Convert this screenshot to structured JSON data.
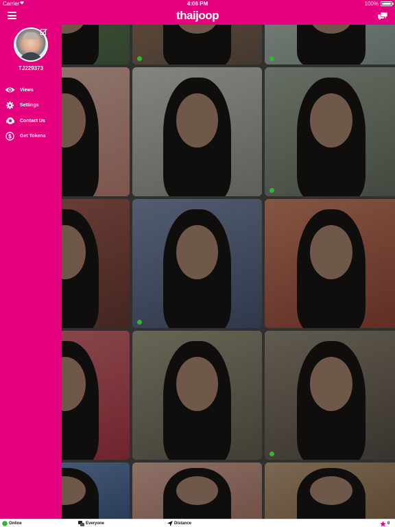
{
  "status_bar": {
    "carrier": "Carrier",
    "time": "4:06 PM",
    "battery": "100%"
  },
  "nav": {
    "logo": "thaijoop",
    "menu_icon": "hamburger-menu-icon",
    "chat_icon": "chat-bubbles-icon"
  },
  "sidebar": {
    "username": "TJ229373",
    "items": [
      {
        "label": "Views",
        "icon": "eye-icon"
      },
      {
        "label": "Settings",
        "icon": "gear-icon"
      },
      {
        "label": "Contact Us",
        "icon": "support-icon"
      },
      {
        "label": "Get Tokens",
        "icon": "dollar-coin-icon"
      }
    ]
  },
  "grid": {
    "online_status": [
      true,
      true,
      true,
      true,
      false,
      true,
      true,
      true,
      false,
      true,
      false,
      true,
      false,
      false,
      false
    ]
  },
  "bottom_bar": {
    "online": "Online",
    "everyone": "Everyone",
    "distance": "Distance",
    "tokens": "0"
  },
  "colors": {
    "brand": "#e5007e",
    "online": "#2fb82f"
  }
}
